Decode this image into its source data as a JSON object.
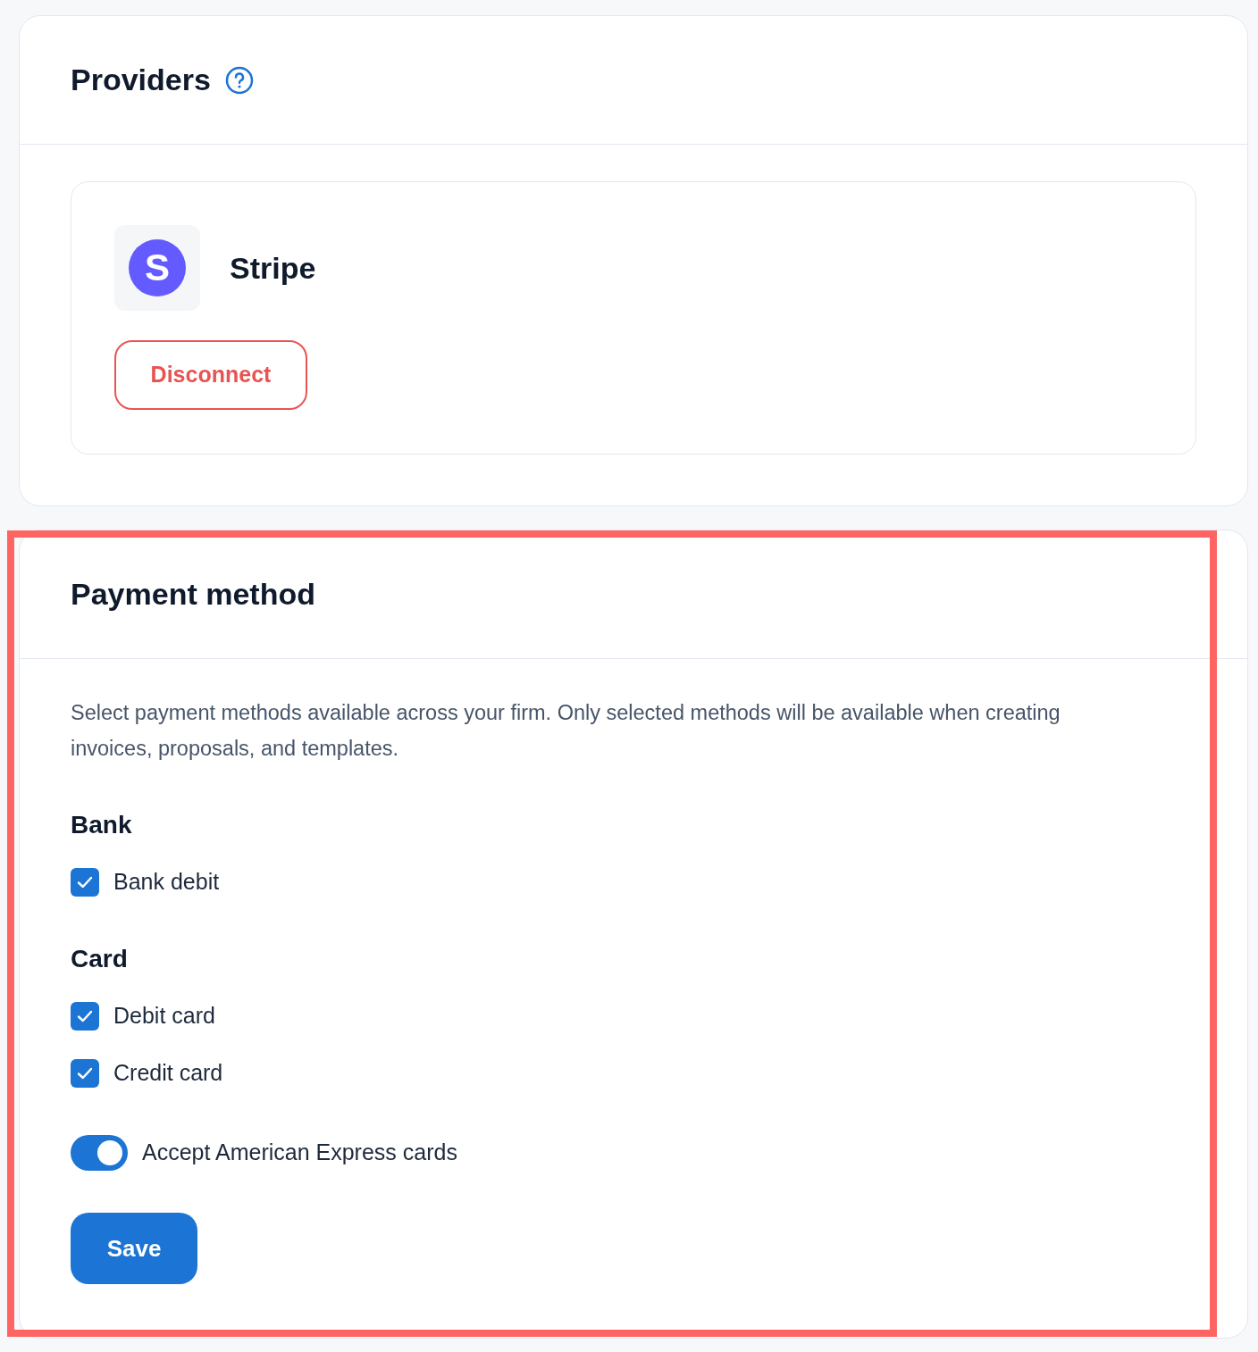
{
  "providers": {
    "title": "Providers",
    "items": [
      {
        "logo_text": "S",
        "name": "Stripe",
        "action": "Disconnect"
      }
    ]
  },
  "payment_method": {
    "title": "Payment method",
    "highlighted": true,
    "description": "Select payment methods available across your firm. Only selected methods will be available when creating invoices, proposals, and templates.",
    "groups": [
      {
        "title": "Bank",
        "options": [
          {
            "label": "Bank debit",
            "checked": true
          }
        ]
      },
      {
        "title": "Card",
        "options": [
          {
            "label": "Debit card",
            "checked": true
          },
          {
            "label": "Credit card",
            "checked": true
          }
        ]
      }
    ],
    "amex_toggle": {
      "label": "Accept American Express cards",
      "on": true
    },
    "save_button": "Save"
  }
}
